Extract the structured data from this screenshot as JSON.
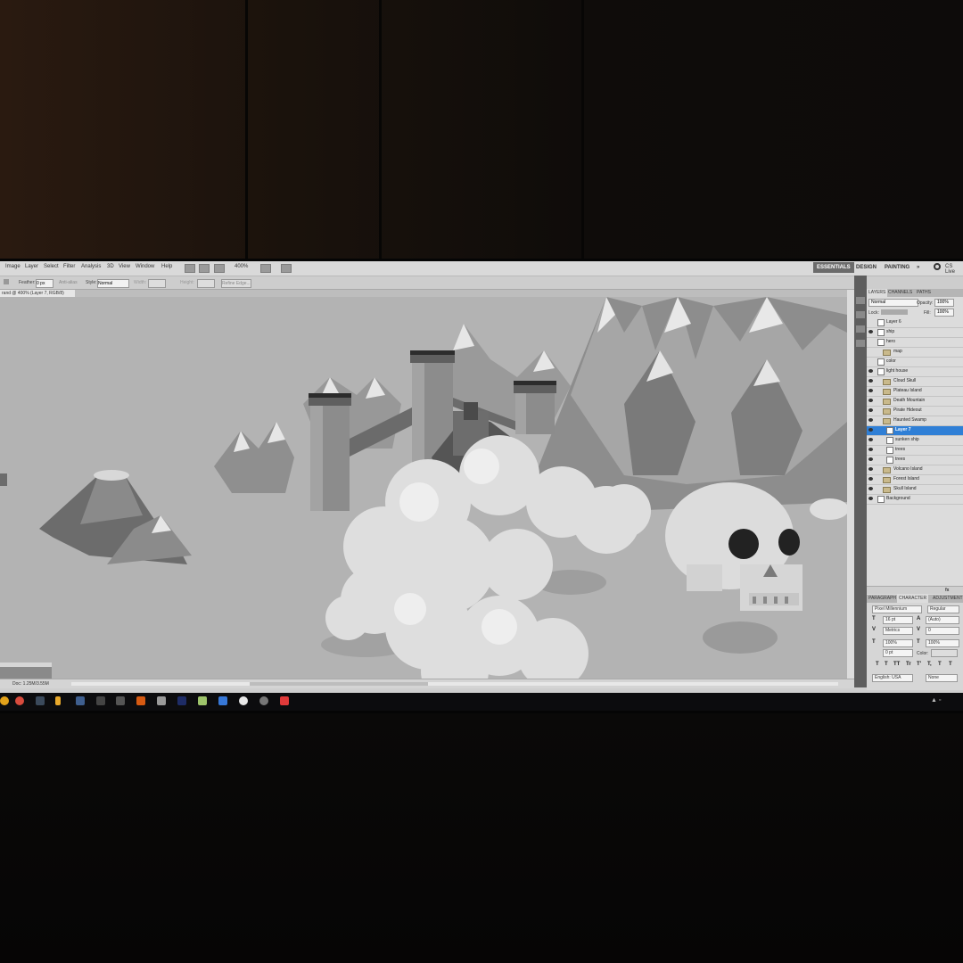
{
  "menu": {
    "items": [
      "Image",
      "Layer",
      "Select",
      "Filter",
      "Analysis",
      "3D",
      "View",
      "Window",
      "Help"
    ],
    "zoom": "400%",
    "workspaces": [
      "ESSENTIALS",
      "DESIGN",
      "PAINTING",
      "»"
    ],
    "cs_live": "CS Live"
  },
  "options": {
    "feather_label": "Feather:",
    "feather_value": "0 px",
    "antialias": "Anti-alias",
    "style_label": "Style:",
    "style_value": "Normal",
    "width_label": "Width:",
    "height_label": "Height:",
    "refine_edge": "Refine Edge..."
  },
  "document": {
    "tab_title": "rand @ 400% (Layer 7, RGB/8)",
    "status": "Doc: 1.25M/3.55M"
  },
  "layers_panel": {
    "tabs": [
      "LAYERS",
      "CHANNELS",
      "PATHS"
    ],
    "blend_mode": "Normal",
    "opacity_label": "Opacity:",
    "opacity_value": "100%",
    "lock_label": "Lock:",
    "fill_label": "Fill:",
    "fill_value": "100%",
    "layers": [
      {
        "name": "Layer 6",
        "visible": false,
        "type": "layer",
        "indent": 0
      },
      {
        "name": "ship",
        "visible": true,
        "type": "layer",
        "indent": 0
      },
      {
        "name": "hero",
        "visible": false,
        "type": "layer",
        "indent": 0
      },
      {
        "name": "map",
        "visible": false,
        "type": "group",
        "indent": 0
      },
      {
        "name": "color",
        "visible": false,
        "type": "layer",
        "indent": 0
      },
      {
        "name": "light house",
        "visible": true,
        "type": "layer",
        "indent": 0
      },
      {
        "name": "Cloud Skull",
        "visible": true,
        "type": "group",
        "indent": 0
      },
      {
        "name": "Plateau Island",
        "visible": true,
        "type": "group",
        "indent": 0
      },
      {
        "name": "Death Mountain",
        "visible": true,
        "type": "group",
        "indent": 0
      },
      {
        "name": "Pirate Hideout",
        "visible": true,
        "type": "group",
        "indent": 0
      },
      {
        "name": "Haunted Swamp",
        "visible": true,
        "type": "group",
        "indent": 0
      },
      {
        "name": "Layer 7",
        "visible": true,
        "type": "layer",
        "indent": 1,
        "selected": true
      },
      {
        "name": "sunken ship",
        "visible": true,
        "type": "layer",
        "indent": 1
      },
      {
        "name": "trees",
        "visible": true,
        "type": "layer",
        "indent": 1
      },
      {
        "name": "trees",
        "visible": true,
        "type": "layer",
        "indent": 1
      },
      {
        "name": "Volcano Island",
        "visible": true,
        "type": "group",
        "indent": 0
      },
      {
        "name": "Forest Island",
        "visible": true,
        "type": "group",
        "indent": 0
      },
      {
        "name": "Skull Island",
        "visible": true,
        "type": "group",
        "indent": 0
      },
      {
        "name": "Background",
        "visible": true,
        "type": "layer",
        "indent": 0
      }
    ]
  },
  "character_panel": {
    "tabs": [
      "PARAGRAPH",
      "CHARACTER",
      "ADJUSTMENTS"
    ],
    "font_family": "Pixel Millennium",
    "font_style": "Regular",
    "font_size": "16 pt",
    "leading": "(Auto)",
    "kerning": "Metrics",
    "tracking": "0",
    "vertical_scale": "100%",
    "horizontal_scale": "100%",
    "baseline_shift": "0 pt",
    "color_label": "Color:",
    "type_buttons": [
      "T",
      "T",
      "TT",
      "Tr",
      "T'",
      "T,",
      "T",
      "T"
    ],
    "language": "English: USA",
    "antialias_mode": "None"
  },
  "taskbar": {
    "icons": [
      "chrome-icon",
      "app-icon",
      "lock-icon",
      "terminal-icon",
      "media-icon",
      "vlc-icon",
      "folder-icon",
      "photoshop-icon",
      "notepad-icon",
      "visual-studio-icon",
      "circle-app-icon",
      "settings-icon",
      "red-app-icon"
    ]
  }
}
